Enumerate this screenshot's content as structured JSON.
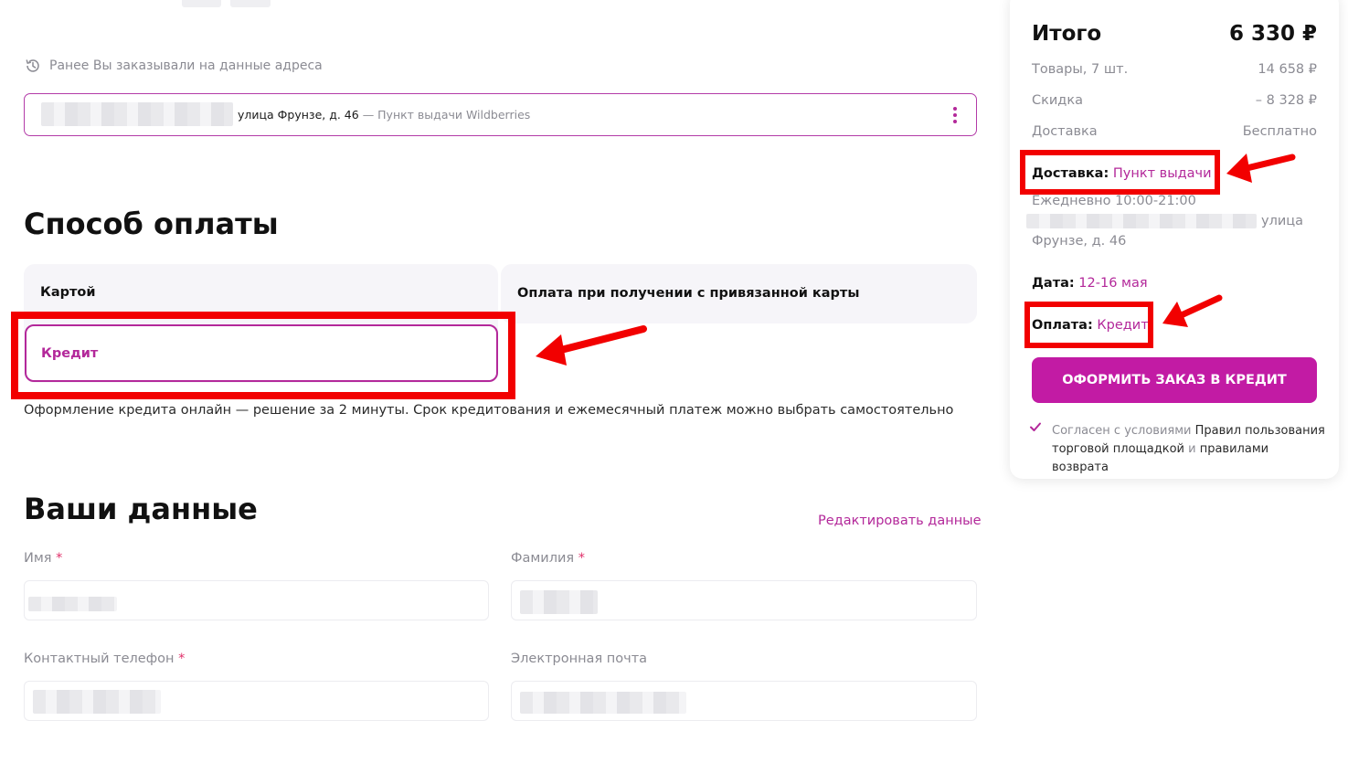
{
  "address": {
    "previous_hint": "Ранее Вы заказывали на данные адреса",
    "street": "улица Фрунзе, д. 46",
    "pickup_type": "— Пункт выдачи Wildberries"
  },
  "payment": {
    "heading": "Способ оплаты",
    "tabs": [
      {
        "label": "Картой"
      },
      {
        "label": "Оплата при получении с привязанной карты"
      },
      {
        "label": "Кредит"
      }
    ],
    "description": "Оформление кредита онлайн — решение за 2 минуты. Срок кредитования и ежемесячный платеж можно выбрать самостоятельно"
  },
  "user_data": {
    "heading": "Ваши данные",
    "edit_link": "Редактировать данные",
    "fields": {
      "first_name_label": "Имя",
      "last_name_label": "Фамилия",
      "phone_label": "Контактный телефон",
      "email_label": "Электронная почта",
      "required_mark": "*"
    }
  },
  "summary": {
    "title": "Итого",
    "total": "6 330 ₽",
    "rows": [
      {
        "label": "Товары, 7 шт.",
        "value": "14 658 ₽"
      },
      {
        "label": "Скидка",
        "value": "– 8 328 ₽"
      },
      {
        "label": "Доставка",
        "value": "Бесплатно"
      }
    ],
    "delivery_label": "Доставка:",
    "delivery_value": "Пункт выдачи",
    "schedule": "Ежедневно 10:00-21:00",
    "address_part1": "улица",
    "address_part2": "Фрунзе, д. 46",
    "date_label": "Дата:",
    "date_value": "12-16 мая",
    "payment_label": "Оплата:",
    "payment_value": "Кредит",
    "order_button": "ОФОРМИТЬ ЗАКАЗ В КРЕДИТ",
    "agree_prefix": "Согласен с условиями",
    "agree_rules": "Правил пользования торговой площадкой",
    "agree_and": "и",
    "agree_return": "правилами возврата"
  },
  "colors": {
    "brand": "#c21ba4",
    "accent_text": "#b3289a",
    "annotation_red": "#f20000",
    "muted_text": "#8b8b93"
  },
  "icons": {
    "history": "history-icon",
    "more": "kebab-menu-icon",
    "check": "checkmark-icon",
    "annotation": "red-arrow-icon"
  }
}
